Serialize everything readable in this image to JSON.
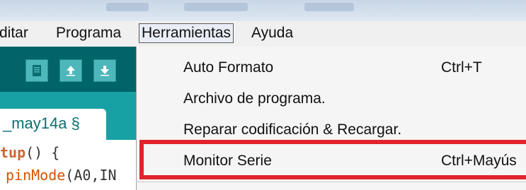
{
  "menubar": {
    "items": [
      "Editar",
      "Programa",
      "Herramientas",
      "Ayuda"
    ],
    "visible_labels": [
      "ditar",
      "Programa",
      "Herramientas",
      "Ayuda"
    ]
  },
  "toolbar": {
    "icons": [
      "document-icon",
      "upload-icon",
      "download-icon"
    ]
  },
  "editor": {
    "tab_label": "_may14a §",
    "code_lines": [
      "tup() {",
      "pinMode(A0,IN"
    ]
  },
  "dropdown": {
    "items": [
      {
        "label": "Auto Formato",
        "shortcut": "Ctrl+T"
      },
      {
        "label": "Archivo de programa.",
        "shortcut": ""
      },
      {
        "label": "Reparar codificación & Recargar.",
        "shortcut": ""
      },
      {
        "label": "Monitor Serie",
        "shortcut": "Ctrl+Mayús"
      }
    ]
  },
  "colors": {
    "toolbar_bg": "#006468",
    "tabstrip_bg": "#17a1a5",
    "highlight_border": "#e1232c"
  }
}
